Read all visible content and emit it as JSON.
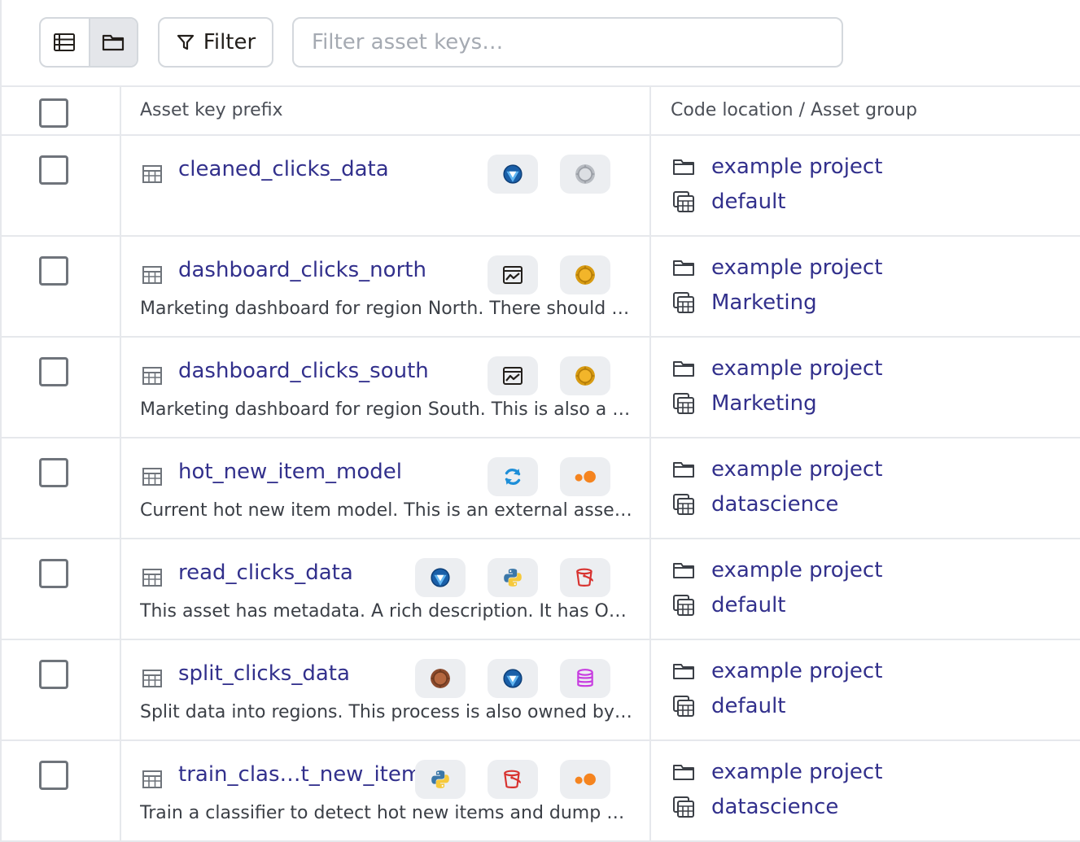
{
  "toolbar": {
    "filter_label": "Filter",
    "search_placeholder": "Filter asset keys…"
  },
  "table": {
    "headers": {
      "asset_key_prefix": "Asset key prefix",
      "code_location_group": "Code location / Asset group"
    },
    "rows": [
      {
        "name": "cleaned_clicks_data",
        "description": "",
        "tags": [
          "globe-icon",
          "gear-badge-gray-icon"
        ],
        "location": "example project",
        "group": "default"
      },
      {
        "name": "dashboard_clicks_north",
        "description": "Marketing dashboard for region North. There should be…",
        "tags": [
          "dashboard-chart-icon",
          "gear-badge-gold-icon"
        ],
        "location": "example project",
        "group": "Marketing"
      },
      {
        "name": "dashboard_clicks_south",
        "description": "Marketing dashboard for region South. This is also a d…",
        "tags": [
          "dashboard-chart-icon",
          "gear-badge-gold-icon"
        ],
        "location": "example project",
        "group": "Marketing"
      },
      {
        "name": "hot_new_item_model",
        "description": "Current hot new item model. This is an external asset, …",
        "tags": [
          "sync-icon",
          "orange-dots-icon"
        ],
        "location": "example project",
        "group": "datascience"
      },
      {
        "name": "read_clicks_data",
        "description": "This asset has metadata. A rich description. It has Own…",
        "tags": [
          "globe-icon",
          "python-icon",
          "bucket-icon"
        ],
        "location": "example project",
        "group": "default"
      },
      {
        "name": "split_clicks_data",
        "description": "Split data into regions. This process is also owned by D…",
        "tags": [
          "gear-badge-bronze-icon",
          "globe-icon",
          "database-icon"
        ],
        "location": "example project",
        "group": "default"
      },
      {
        "name": "train_clas…t_new_item",
        "description": "Train a classifier to detect hot new items and dump mo…",
        "tags": [
          "python-icon",
          "bucket-icon",
          "orange-dots-icon"
        ],
        "location": "example project",
        "group": "datascience"
      }
    ]
  },
  "colors": {
    "link": "#32308c",
    "border": "#e6e8ec",
    "tag_bg": "#eceef1"
  }
}
